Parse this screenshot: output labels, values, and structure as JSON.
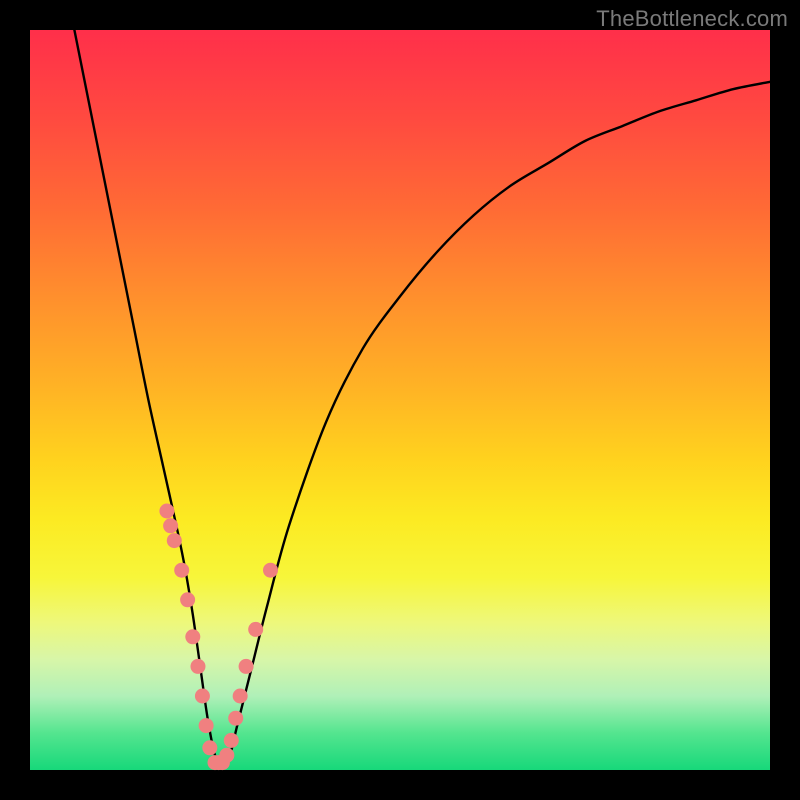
{
  "watermark": "TheBottleneck.com",
  "colors": {
    "frame": "#000000",
    "curve": "#000000",
    "marker": "#f08080",
    "watermark": "#7a7a7a"
  },
  "chart_data": {
    "type": "line",
    "title": "",
    "xlabel": "",
    "ylabel": "",
    "xlim": [
      0,
      100
    ],
    "ylim": [
      0,
      100
    ],
    "series": [
      {
        "name": "bottleneck-curve",
        "x": [
          6,
          8,
          10,
          12,
          14,
          16,
          18,
          20,
          21,
          22,
          23,
          24,
          25,
          26,
          27,
          28,
          30,
          32,
          35,
          40,
          45,
          50,
          55,
          60,
          65,
          70,
          75,
          80,
          85,
          90,
          95,
          100
        ],
        "y": [
          100,
          90,
          80,
          70,
          60,
          50,
          41,
          32,
          27,
          21,
          14,
          7,
          2,
          1,
          2,
          6,
          14,
          22,
          33,
          47,
          57,
          64,
          70,
          75,
          79,
          82,
          85,
          87,
          89,
          90.5,
          92,
          93
        ]
      }
    ],
    "markers": {
      "name": "sample-points",
      "x": [
        18.5,
        19.0,
        19.5,
        20.5,
        21.3,
        22.0,
        22.7,
        23.3,
        23.8,
        24.3,
        25.0,
        25.5,
        26.0,
        26.6,
        27.2,
        27.8,
        28.4,
        29.2,
        30.5,
        32.5
      ],
      "y": [
        35,
        33,
        31,
        27,
        23,
        18,
        14,
        10,
        6,
        3,
        1,
        1,
        1,
        2,
        4,
        7,
        10,
        14,
        19,
        27
      ]
    }
  }
}
